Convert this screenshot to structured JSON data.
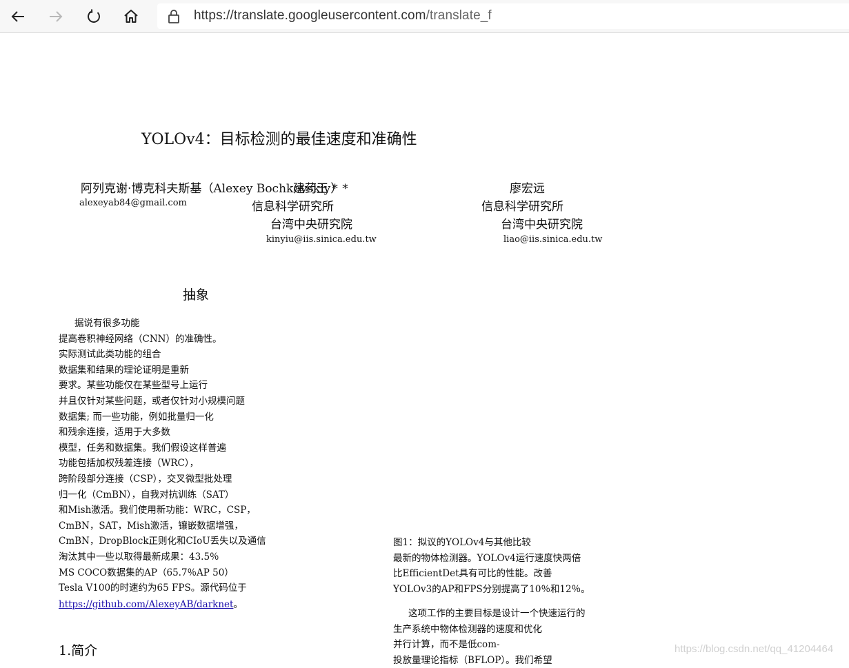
{
  "browser": {
    "url_host": "https://translate.googleusercontent.com",
    "url_path": "/translate_f"
  },
  "paper": {
    "title": "YOLOv4：目标检测的最佳速度和准确性",
    "author1_name": "阿列克谢·博克科夫斯基（Alexey Bochkovskiy）*",
    "author1_email": "alexeyab84@gmail.com",
    "author2_name": "建药王 *",
    "author2_affil1": "信息科学研究所",
    "author2_affil2": "台湾中央研究院",
    "author2_email": "kinyiu@iis.sinica.edu.tw",
    "author3_name": "廖宏远",
    "author3_affil1": "信息科学研究所",
    "author3_affil2": "台湾中央研究院",
    "author3_email": "liao@iis.sinica.edu.tw",
    "abstract_heading": "抽象",
    "abstract_lines": [
      "据说有很多功能",
      "提高卷积神经网络（CNN）的准确性。",
      "实际测试此类功能的组合",
      "数据集和结果的理论证明是重新",
      "要求。某些功能仅在某些型号上运行",
      "并且仅针对某些问题，或者仅针对小规模问题",
      "数据集; 而一些功能，例如批量归一化",
      "和残余连接，适用于大多数",
      "模型，任务和数据集。我们假设这样普遍",
      "功能包括加权残差连接（WRC），",
      "跨阶段部分连接（CSP），交叉微型批处理",
      "归一化（CmBN），自我对抗训练（SAT）",
      "和Mish激活。我们使用新功能：WRC，CSP，",
      "CmBN，SAT，Mish激活，镶嵌数据增强，",
      "CmBN，DropBlock正则化和CIoU丢失以及通信",
      "淘汰其中一些以取得最新成果：43.5％",
      "MS COCO数据集的AP（65.7％AP 50）",
      "Tesla V100的时速约为65 FPS。源代码位于"
    ],
    "abstract_link": "https://github.com/AlexeyAB/darknet",
    "abstract_link_suffix": "。",
    "intro_heading": "1.简介",
    "figure_caption_lines": [
      "图1：拟议的YOLOv4与其他比较",
      "最新的物体检测器。YOLOv4运行速度快两倍",
      "比EfficientDet具有可比的性能。改善",
      "YOLOv3的AP和FPS分别提高了10％和12％。"
    ],
    "intro_lines": [
      "这项工作的主要目标是设计一个快速运行的",
      "生产系统中物体检测器的速度和优化",
      "并行计算，而不是低com-",
      "投放量理论指标（BFLOP）。我们希望"
    ]
  },
  "watermark": "https://blog.csdn.net/qq_41204464"
}
